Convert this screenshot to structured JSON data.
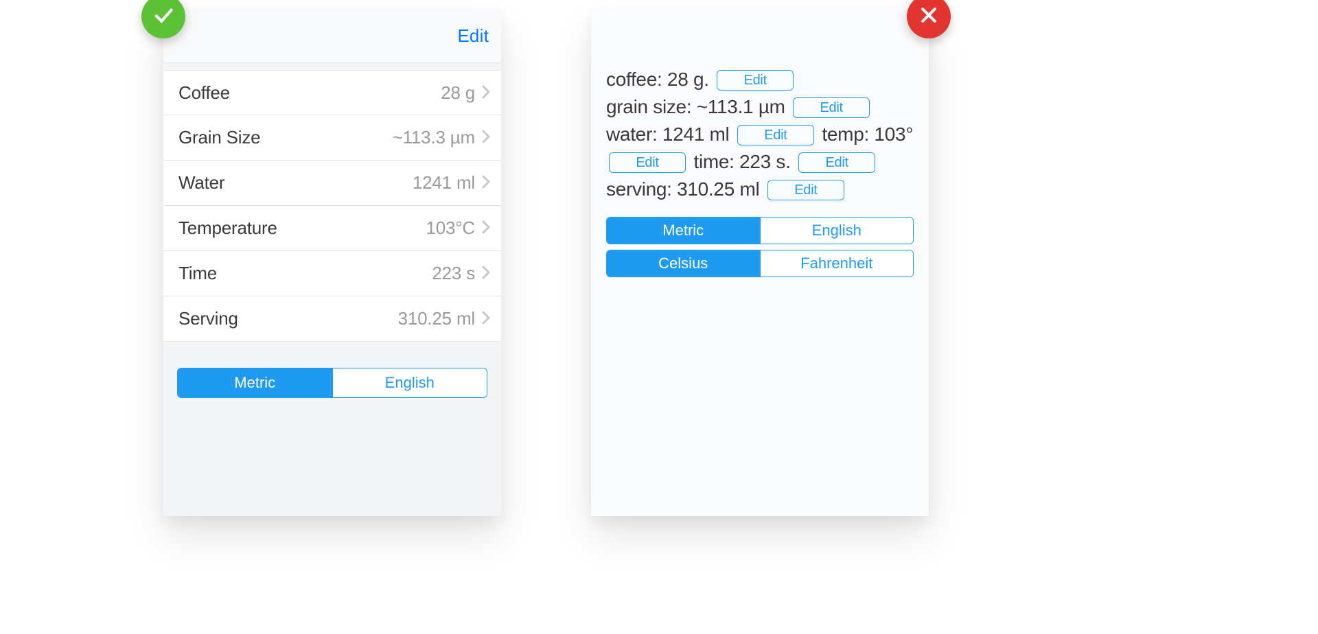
{
  "good": {
    "edit_label": "Edit",
    "rows": [
      {
        "label": "Coffee",
        "value": "28 g"
      },
      {
        "label": "Grain Size",
        "value": "~113.3 µm"
      },
      {
        "label": "Water",
        "value": "1241 ml"
      },
      {
        "label": "Temperature",
        "value": "103°C"
      },
      {
        "label": "Time",
        "value": "223 s"
      },
      {
        "label": "Serving",
        "value": "310.25 ml"
      }
    ],
    "units_segment": {
      "metric": "Metric",
      "english": "English",
      "selected": "metric"
    }
  },
  "bad": {
    "edit_label": "Edit",
    "items": [
      {
        "text": "coffee: 28 g."
      },
      {
        "text": "grain size: ~113.1 µm"
      },
      {
        "text": "water: 1241 ml"
      },
      {
        "text": "temp: 103°"
      },
      {
        "text": "time: 223 s."
      },
      {
        "text": "serving: 310.25 ml"
      }
    ],
    "units_segment": {
      "metric": "Metric",
      "english": "English",
      "selected": "metric"
    },
    "temp_segment": {
      "celsius": "Celsius",
      "fahrenheit": "Fahrenheit",
      "selected": "celsius"
    }
  }
}
